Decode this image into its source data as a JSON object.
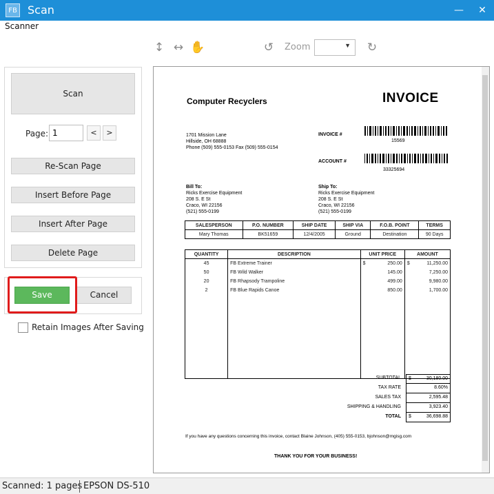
{
  "window": {
    "app_icon_text": "FB",
    "title": "Scan",
    "minimize_glyph": "—",
    "close_glyph": "✕"
  },
  "menu": {
    "scanner_label": "Scanner"
  },
  "toolbar": {
    "fit_height_icon": "↕",
    "fit_width_icon": "↔",
    "pan_icon": "✋",
    "rotate_left_icon": "↺",
    "rotate_right_icon": "↻",
    "zoom_label": "Zoom",
    "zoom_value": "",
    "zoom_dropdown_glyph": "▼"
  },
  "scan_panel": {
    "scan_button": "Scan",
    "page_label": "Page:",
    "page_value": "1",
    "prev_page": "<",
    "next_page": ">",
    "rescan_button": "Re-Scan Page",
    "insert_before_button": "Insert Before Page",
    "insert_after_button": "Insert After Page",
    "delete_button": "Delete Page"
  },
  "actions": {
    "save_button": "Save",
    "cancel_button": "Cancel",
    "retain_images_label": "Retain Images After Saving",
    "retain_images_checked": false
  },
  "status": {
    "scanned": "Scanned: 1 pages",
    "device": "EPSON DS-510"
  },
  "invoice": {
    "company": "Computer Recyclers",
    "doc_title": "INVOICE",
    "address_lines": [
      "1701 Mission Lane",
      "Hillside, OH  68888",
      "Phone (509) 555-0153   Fax (509) 555-0154"
    ],
    "invoice_no_label": "INVOICE #",
    "invoice_no": "15569",
    "account_label": "ACCOUNT #",
    "account_no": "33325694",
    "bill_to_label": "Bill To:",
    "bill_to": [
      "Ricks Exercise Equipment",
      "208 S. E St",
      "Craco, WI  22156",
      "(521) 555-0199"
    ],
    "ship_to_label": "Ship To:",
    "ship_to": [
      "Ricks Exercise Equipment",
      "208 S. E St",
      "Craco, WI  22156",
      "(521) 555-0199"
    ],
    "order_headers": [
      "SALESPERSON",
      "P.O. NUMBER",
      "SHIP DATE",
      "SHIP VIA",
      "F.O.B. POINT",
      "TERMS"
    ],
    "order_values": [
      "Mary Thomas",
      "BK51659",
      "12/4/2005",
      "Ground",
      "Destination",
      "90 Days"
    ],
    "item_headers": [
      "QUANTITY",
      "DESCRIPTION",
      "UNIT PRICE",
      "AMOUNT"
    ],
    "items": [
      {
        "qty": "45",
        "desc": "FB Extreme Trainer",
        "cur1": "$",
        "price": "250.00",
        "cur2": "$",
        "amount": "11,250.00"
      },
      {
        "qty": "50",
        "desc": "FB Wild Walker",
        "cur1": "",
        "price": "145.00",
        "cur2": "",
        "amount": "7,250.00"
      },
      {
        "qty": "20",
        "desc": "FB Rhapsody Trampoline",
        "cur1": "",
        "price": "499.00",
        "cur2": "",
        "amount": "9,980.00"
      },
      {
        "qty": "2",
        "desc": "FB Blue Rapids Canoe",
        "cur1": "",
        "price": "850.00",
        "cur2": "",
        "amount": "1,700.00"
      }
    ],
    "subtotal_label": "SUBTOTAL",
    "subtotal_cur": "$",
    "subtotal": "30,180.00",
    "tax_rate_label": "TAX RATE",
    "tax_rate": "8.60%",
    "sales_tax_label": "SALES TAX",
    "sales_tax": "2,595.48",
    "shipping_label": "SHIPPING & HANDLING",
    "shipping": "3,923.40",
    "total_label": "TOTAL",
    "total_cur": "$",
    "total": "36,698.88",
    "questions_line": "If you have any questions concerning this invoice, contact Blaine Johnson, (405) 555-0153, bjohnson@mgisg.com",
    "thanks_line": "THANK YOU FOR YOUR BUSINESS!"
  }
}
